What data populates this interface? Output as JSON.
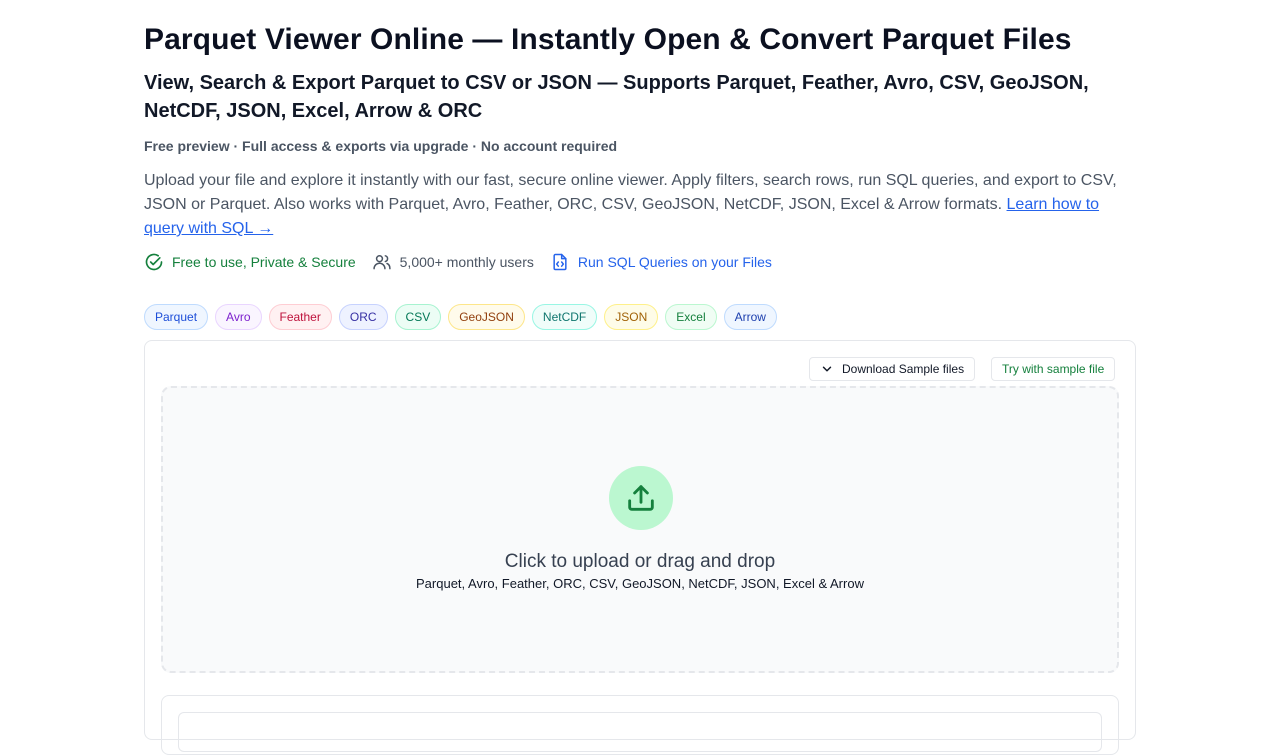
{
  "header": {
    "title": "Parquet Viewer Online — Instantly Open & Convert Parquet Files",
    "subtitle": "View, Search & Export Parquet to CSV or JSON — Supports Parquet, Feather, Avro, CSV, GeoJSON, NetCDF, JSON, Excel, Arrow & ORC",
    "tagline": "Free preview · Full access & exports via upgrade · No account required",
    "description": "Upload your file and explore it instantly with our fast, secure online viewer. Apply filters, search rows, run SQL queries, and export to CSV, JSON or Parquet. Also works with Parquet, Avro, Feather, ORC, CSV, GeoJSON, NetCDF, JSON, Excel & Arrow formats. ",
    "learn_link": "Learn how to query with SQL →"
  },
  "features": {
    "free": {
      "label": "Free to use, Private & Secure",
      "icon": "check-circle-icon"
    },
    "users": {
      "label": "5,000+ monthly users",
      "icon": "users-icon"
    },
    "sql": {
      "label": "Run SQL Queries on your Files",
      "icon": "sql-file-icon"
    }
  },
  "format_chips": [
    {
      "label": "Parquet",
      "color": "#1d4ed8",
      "bg": "#eff6ff",
      "border": "#bfdbfe"
    },
    {
      "label": "Avro",
      "color": "#7e22ce",
      "bg": "#faf5ff",
      "border": "#e9d5ff"
    },
    {
      "label": "Feather",
      "color": "#be123c",
      "bg": "#fff1f2",
      "border": "#fecdd3"
    },
    {
      "label": "ORC",
      "color": "#3730a3",
      "bg": "#eef2ff",
      "border": "#c7d2fe"
    },
    {
      "label": "CSV",
      "color": "#047857",
      "bg": "#ecfdf5",
      "border": "#a7f3d0"
    },
    {
      "label": "GeoJSON",
      "color": "#92400e",
      "bg": "#fffbeb",
      "border": "#fde68a"
    },
    {
      "label": "NetCDF",
      "color": "#0f766e",
      "bg": "#f0fdfa",
      "border": "#99f6e4"
    },
    {
      "label": "JSON",
      "color": "#a16207",
      "bg": "#fefce8",
      "border": "#fef08a"
    },
    {
      "label": "Excel",
      "color": "#15803d",
      "bg": "#f0fdf4",
      "border": "#bbf7d0"
    },
    {
      "label": "Arrow",
      "color": "#1e40af",
      "bg": "#eff6ff",
      "border": "#bfdbfe"
    }
  ],
  "panel": {
    "download_samples_label": "Download Sample files",
    "try_sample_label": "Try with sample file",
    "dropzone": {
      "title": "Click to upload or drag and drop",
      "subtitle": "Parquet, Avro, Feather, ORC, CSV, GeoJSON, NetCDF, JSON, Excel & Arrow",
      "icon": "upload-icon"
    }
  }
}
